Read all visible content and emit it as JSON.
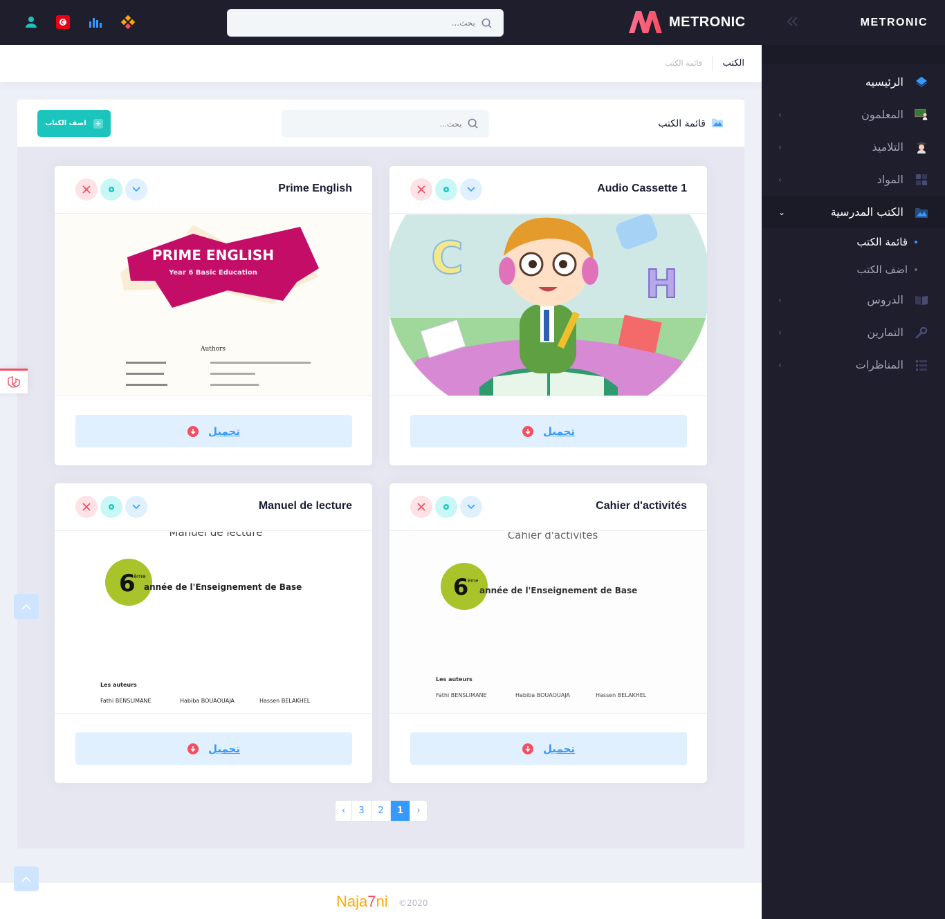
{
  "header": {
    "search_placeholder": "بحث...",
    "brand": "METRONIC",
    "icons": [
      "user-icon",
      "flag-tunisia-icon",
      "chart-bars-icon",
      "apps-grid-icon"
    ]
  },
  "sidebar": {
    "logo": "METRONIC",
    "items": [
      {
        "label": "الرئيسيه",
        "icon": "layers-icon"
      },
      {
        "label": "المعلمون",
        "icon": "teacher-icon"
      },
      {
        "label": "التلاميذ",
        "icon": "student-icon"
      },
      {
        "label": "المواد",
        "icon": "grid-icon"
      },
      {
        "label": "الكتب المدرسية",
        "icon": "folder-image-icon"
      },
      {
        "label": "قائمة الكتب"
      },
      {
        "label": "اضف الكتب"
      },
      {
        "label": "الدروس",
        "icon": "book-open-icon"
      },
      {
        "label": "التمارين",
        "icon": "wrench-icon"
      },
      {
        "label": "المناظرات",
        "icon": "list-icon"
      }
    ]
  },
  "subheader": {
    "title": "الكتب",
    "breadcrumb": "قائمة الكتب"
  },
  "card": {
    "title": "قائمة الكتب",
    "search_placeholder": "بحث...",
    "add_button": "اضف الكتاب"
  },
  "books": [
    {
      "title": "Prime English",
      "download": "تحميل",
      "cover": {
        "heading": "PRIME ENGLISH",
        "subheading": "Year 6 Basic Education",
        "authors_label": "Authors"
      }
    },
    {
      "title": "Audio Cassette 1",
      "download": "تحميل"
    },
    {
      "title": "Manuel de lecture",
      "download": "تحميل",
      "cover": {
        "top": "Manuel de lecture",
        "num": "6",
        "sup": "ème",
        "line": "année de l'Enseignement de Base",
        "authors_label": "Les auteurs",
        "authors": [
          "Fathi BENSLIMANE",
          "Habiba BOUAOUAJA",
          "Hassen BELAKHEL"
        ]
      }
    },
    {
      "title": "Cahier d'activités",
      "download": "تحميل",
      "cover": {
        "top": "Cahier d'activités",
        "num": "6",
        "sup": "ème",
        "line": "année de l'Enseignement de Base",
        "authors_label": "Les auteurs",
        "authors": [
          "Fathi BENSLIMANE",
          "Habiba BOUAOUAJA",
          "Hassen BELAKHEL"
        ]
      }
    }
  ],
  "pagination": {
    "prev": "‹",
    "pages": [
      "3",
      "2",
      "1"
    ],
    "next": "›",
    "active": "1"
  },
  "footer": {
    "brand_a": "Naja",
    "brand_b": "7",
    "brand_c": "ni",
    "year": "©2020"
  },
  "colors": {
    "dark": "#1e1e2d",
    "primary": "#3699ff",
    "success": "#1bc5bd",
    "danger": "#f64e60"
  }
}
